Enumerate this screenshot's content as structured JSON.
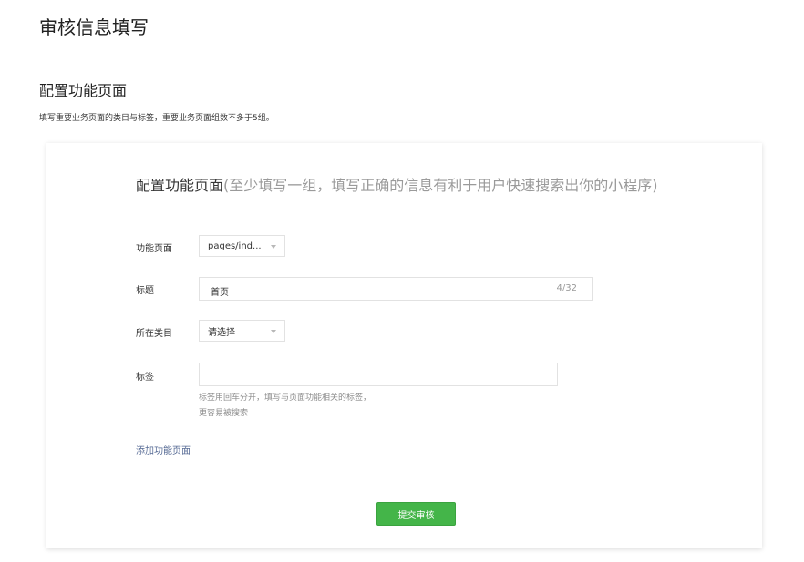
{
  "page": {
    "title": "审核信息填写",
    "section_title": "配置功能页面",
    "section_desc": "填写重要业务页面的类目与标签，重要业务页面组数不多于5组。"
  },
  "card": {
    "title_main": "配置功能页面",
    "title_hint": "(至少填写一组，填写正确的信息有利于用户快速搜索出你的小程序)",
    "function_page": {
      "label": "功能页面",
      "value": "pages/ind..."
    },
    "title_field": {
      "label": "标题",
      "value": "首页",
      "counter": "4/32"
    },
    "category": {
      "label": "所在类目",
      "value": "请选择"
    },
    "tags": {
      "label": "标签",
      "value": "",
      "tip_line1": "标签用回车分开，填写与页面功能相关的标签，",
      "tip_line2": "更容易被搜索"
    },
    "add_link": "添加功能页面",
    "submit_label": "提交审核"
  },
  "colors": {
    "accent_green": "#44b549",
    "link_blue": "#576b95"
  }
}
